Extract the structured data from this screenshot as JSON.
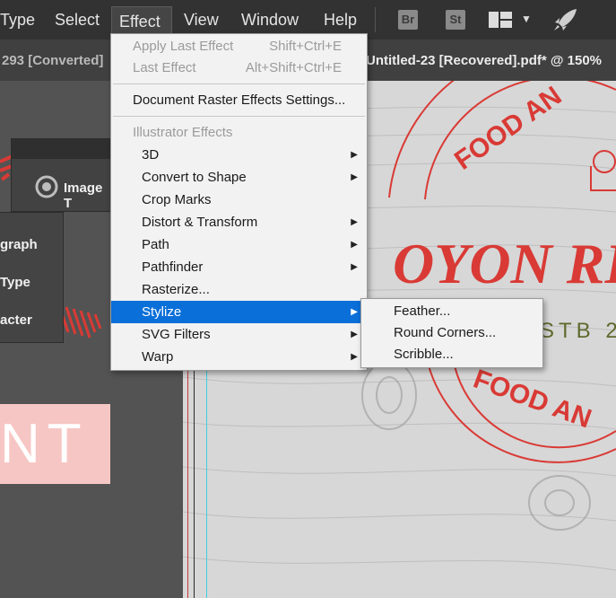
{
  "menubar": {
    "items": [
      "Type",
      "Select",
      "Effect",
      "View",
      "Window",
      "Help"
    ],
    "active": "Effect",
    "apps": [
      "Br",
      "St"
    ]
  },
  "tabs": {
    "left": "293 [Converted]",
    "right": "Untitled-23 [Recovered].pdf* @ 150%"
  },
  "panels": {
    "image_title": "Image T",
    "type_items": [
      "graph",
      "Type",
      "acter"
    ]
  },
  "canvas_text": {
    "pink_letters": "NT"
  },
  "effect_menu": {
    "apply_last": {
      "label": "Apply Last Effect",
      "shortcut": "Shift+Ctrl+E"
    },
    "last_effect": {
      "label": "Last Effect",
      "shortcut": "Alt+Shift+Ctrl+E"
    },
    "raster_settings": "Document Raster Effects Settings...",
    "section_header": "Illustrator Effects",
    "items": [
      "3D",
      "Convert to Shape",
      "Crop Marks",
      "Distort & Transform",
      "Path",
      "Pathfinder",
      "Rasterize...",
      "Stylize",
      "SVG Filters",
      "Warp"
    ]
  },
  "stylize_menu": {
    "items": [
      "Feather...",
      "Round Corners...",
      "Scribble..."
    ]
  },
  "logo": {
    "top_arc": "FOOD AN",
    "bottom_arc": "FOOD AN",
    "name": "OYON RES",
    "est": "STB 2"
  },
  "colors": {
    "menu_bg": "#f2f2f2",
    "highlight": "#0a6fd8",
    "logo_red": "#d93a35",
    "est_olive": "#5e6a2e"
  }
}
